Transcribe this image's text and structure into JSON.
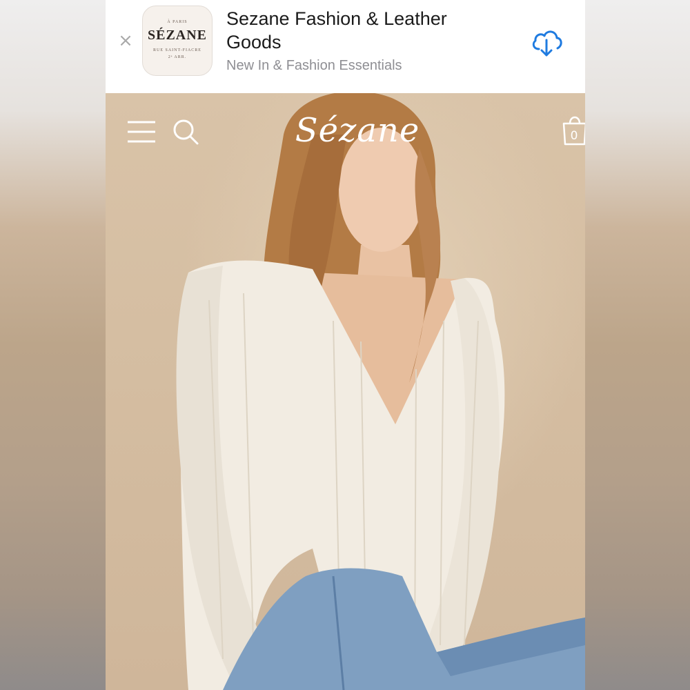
{
  "banner": {
    "close_icon": "close-icon",
    "app_icon": {
      "top_line": "À PARIS",
      "brand": "SÉZANE",
      "address": "RUE SAINT-FIACRE",
      "district": "2ᵉ ARR."
    },
    "title": "Sezane Fashion & Leather Goods",
    "subtitle": "New In & Fashion Essentials",
    "download_icon": "cloud-download-icon",
    "accent_color": "#1f7be0"
  },
  "header": {
    "menu_icon": "hamburger-menu-icon",
    "search_icon": "search-icon",
    "logo_text": "Sézane",
    "bag_icon": "shopping-bag-icon",
    "bag_count": "0"
  }
}
